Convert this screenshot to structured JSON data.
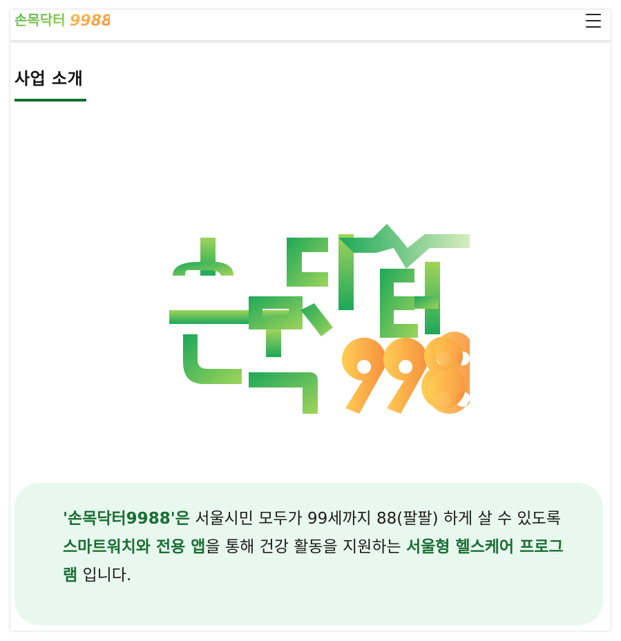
{
  "header": {
    "logo_text": "손목닥터9988",
    "menu_icon": "hamburger-menu-icon"
  },
  "section": {
    "title": "사업 소개"
  },
  "hero": {
    "logo_text": "손목닥터9988"
  },
  "intro": {
    "part1": "'손목닥터9988'은",
    "part2": " 서울시민 모두가 99세까지 88(팔팔) 하게 살 수 있도록 ",
    "part3": "스마트워치와 전용 앱",
    "part4": "을 통해 건강 활동을 지원하는 ",
    "part5": "서울형 헬스케어 프로그램",
    "part6": " 입니다."
  },
  "colors": {
    "accent_green": "#136d2f",
    "logo_green": "#2db55d",
    "logo_light_green": "#a8d65a",
    "logo_orange": "#f59a3f",
    "logo_yellow": "#fbc65c",
    "intro_background": "#e9f8ee"
  }
}
